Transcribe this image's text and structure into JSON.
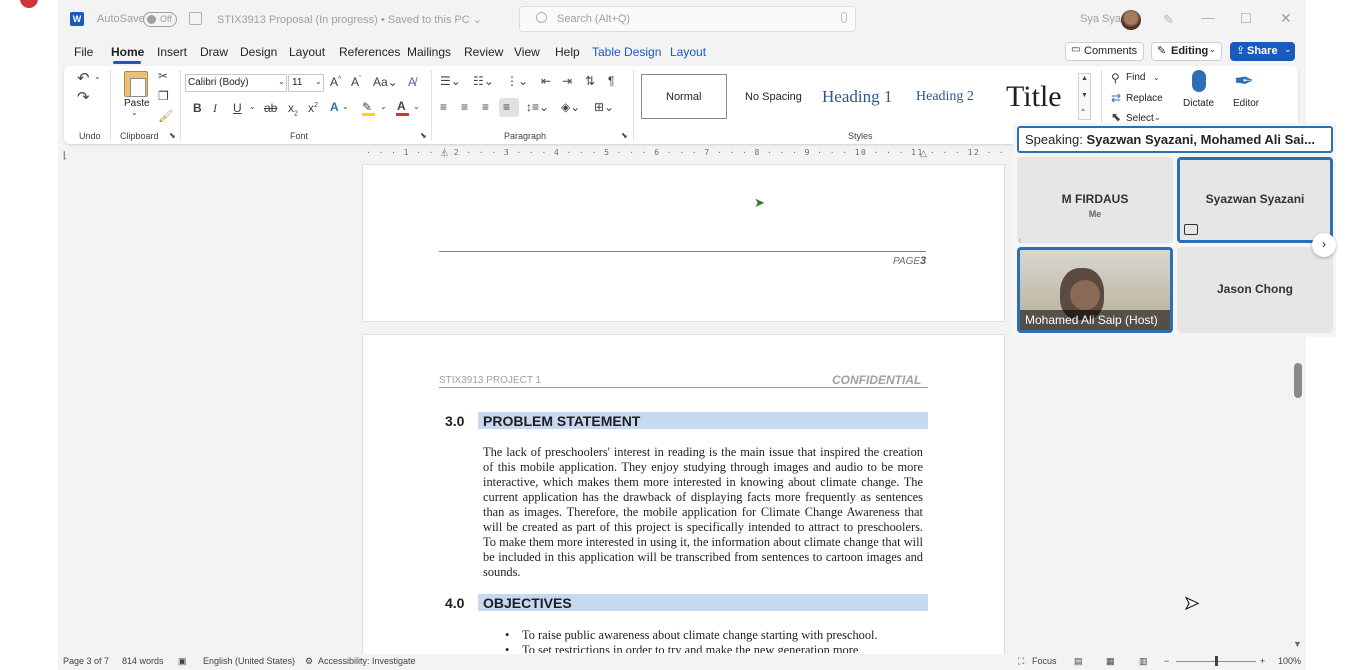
{
  "titlebar": {
    "app_icon": "W",
    "autosave_label": "AutoSave",
    "autosave_state": "Off",
    "doc_title": "STIX3913 Proposal (In progress) • Saved to this PC ⌄",
    "search_placeholder": "Search (Alt+Q)",
    "user_name": "Sya Sya"
  },
  "tabs": [
    "File",
    "Home",
    "Insert",
    "Draw",
    "Design",
    "Layout",
    "References",
    "Mailings",
    "Review",
    "View",
    "Help",
    "Table Design",
    "Layout"
  ],
  "active_tab": "Home",
  "topright": {
    "comments": "Comments",
    "editing": "Editing",
    "share": "Share"
  },
  "ribbon": {
    "groups": {
      "undo": "Undo",
      "clipboard": "Clipboard",
      "font": "Font",
      "paragraph": "Paragraph",
      "styles": "Styles"
    },
    "paste_label": "Paste",
    "font_name": "Calibri (Body)",
    "font_size": "11",
    "styles": {
      "normal": "Normal",
      "no_spacing": "No Spacing",
      "heading1": "Heading 1",
      "heading2": "Heading 2",
      "title": "Title"
    },
    "editing": {
      "find": "Find",
      "replace": "Replace",
      "select": "Select"
    },
    "dictate": "Dictate",
    "editor": "Editor"
  },
  "ruler_ticks": "· · · 1 · · · 2 · · · 3 · · · 4 · · · 5 · · · 6 · · · 7 · · · 8 · · · 9 · · · 10 · · · 11 · · · 12 · · · 13 · · · 14 · · · 15 · · · ·",
  "document": {
    "page_footer_label": "PAGE",
    "page_footer_number": "3",
    "header_left": "STIX3913 PROJECT 1",
    "header_right": "CONFIDENTIAL",
    "sections": [
      {
        "number": "3.0",
        "title": "PROBLEM STATEMENT"
      },
      {
        "number": "4.0",
        "title": "OBJECTIVES"
      }
    ],
    "paragraph": "The lack of preschoolers' interest in reading is the main issue that inspired the creation of this mobile application. They enjoy studying through images and audio to be more interactive, which makes them more interested in knowing about climate change. The current application has the drawback of displaying facts more frequently as sentences than as images. Therefore, the mobile application for Climate Change Awareness that will be created as part of this project is specifically intended to attract to preschoolers. To make them more interested in using it, the information about climate change that will be included in this application will be transcribed from sentences to cartoon images and sounds.",
    "bullets": [
      "To raise public awareness about climate change starting with preschool.",
      "To set restrictions in order to try and make the new generation more"
    ]
  },
  "meeting": {
    "speaking_prefix": "Speaking:",
    "speaking_names": "Syazwan Syazani, Mohamed Ali Sai...",
    "participants": [
      {
        "name": "M FIRDAUS",
        "sub": "Me"
      },
      {
        "name": "Syazwan Syazani"
      },
      {
        "name": "Mohamed Ali Saip (Host)"
      },
      {
        "name": "Jason Chong"
      }
    ]
  },
  "statusbar": {
    "page": "Page 3 of 7",
    "words": "814 words",
    "language": "English (United States)",
    "accessibility": "Accessibility: Investigate",
    "focus": "Focus",
    "zoom": "100%"
  },
  "colors": {
    "accent": "#185abd",
    "section_bar": "#c6d9f1",
    "meeting_border": "#2d6fb4"
  }
}
